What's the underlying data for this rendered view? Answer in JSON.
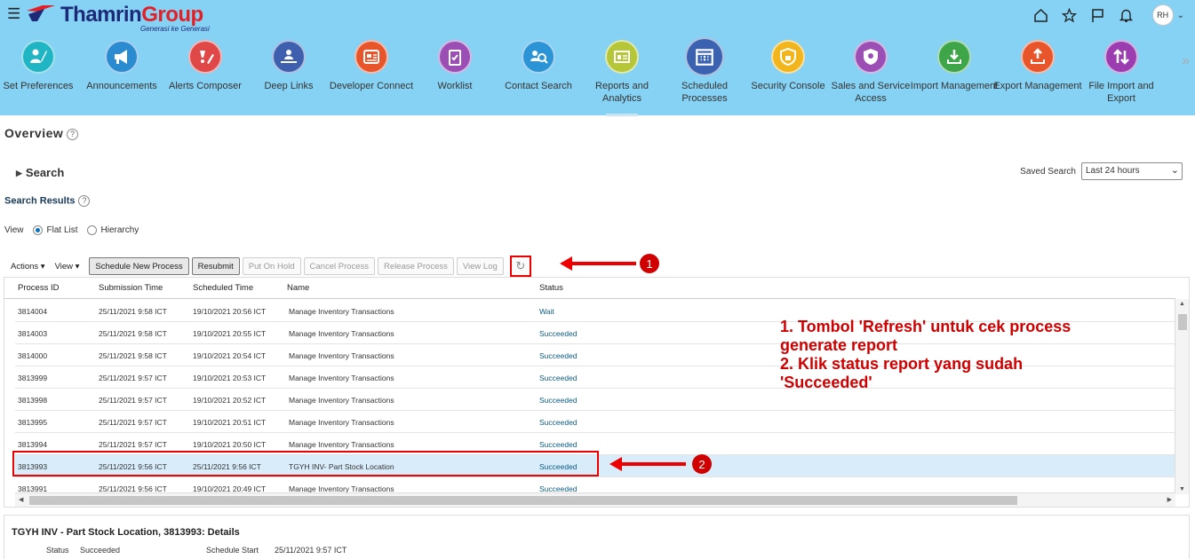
{
  "brand": {
    "name_main": "Thamrin",
    "name_group": "Group",
    "tagline": "Generasi ke Generasi"
  },
  "top_icons": [
    "home-icon",
    "star-icon",
    "flag-icon",
    "bell-icon"
  ],
  "user": {
    "initials": "RH"
  },
  "apps": [
    {
      "label": "Set Preferences",
      "color": "#1fb5c4"
    },
    {
      "label": "Announcements",
      "color": "#2a8bd0"
    },
    {
      "label": "Alerts Composer",
      "color": "#e04848"
    },
    {
      "label": "Deep Links",
      "color": "#3e5fae"
    },
    {
      "label": "Developer Connect",
      "color": "#e8552b"
    },
    {
      "label": "Worklist",
      "color": "#9b4fb5"
    },
    {
      "label": "Contact Search",
      "color": "#2a94d6"
    },
    {
      "label": "Reports and Analytics",
      "color": "#b5c737"
    },
    {
      "label": "Scheduled Processes",
      "color": "#3b62b0"
    },
    {
      "label": "Security Console",
      "color": "#f2b51c"
    },
    {
      "label": "Sales and Service Access",
      "color": "#9b4fb5"
    },
    {
      "label": "Import Management",
      "color": "#3ea548"
    },
    {
      "label": "Export Management",
      "color": "#e8552b"
    },
    {
      "label": "File Import and Export",
      "color": "#9b3db0"
    }
  ],
  "overview": {
    "title": "Overview"
  },
  "search": {
    "label": "Search",
    "saved_label": "Saved Search",
    "saved_value": "Last 24 hours"
  },
  "results": {
    "title": "Search Results"
  },
  "view": {
    "label": "View",
    "flat": "Flat List",
    "hierarchy": "Hierarchy"
  },
  "toolbar": {
    "actions": "Actions",
    "view": "View",
    "schedule": "Schedule New Process",
    "resubmit": "Resubmit",
    "hold": "Put On Hold",
    "cancel": "Cancel Process",
    "release": "Release Process",
    "viewlog": "View Log"
  },
  "columns": [
    "Process ID",
    "Submission Time",
    "Scheduled Time",
    "Name",
    "Status"
  ],
  "rows": [
    [
      "3814004",
      "25/11/2021 9:58 ICT",
      "19/10/2021 20:56 ICT",
      "Manage Inventory Transactions",
      "Wait"
    ],
    [
      "3814003",
      "25/11/2021 9:58 ICT",
      "19/10/2021 20:55 ICT",
      "Manage Inventory Transactions",
      "Succeeded"
    ],
    [
      "3814000",
      "25/11/2021 9:58 ICT",
      "19/10/2021 20:54 ICT",
      "Manage Inventory Transactions",
      "Succeeded"
    ],
    [
      "3813999",
      "25/11/2021 9:57 ICT",
      "19/10/2021 20:53 ICT",
      "Manage Inventory Transactions",
      "Succeeded"
    ],
    [
      "3813998",
      "25/11/2021 9:57 ICT",
      "19/10/2021 20:52 ICT",
      "Manage Inventory Transactions",
      "Succeeded"
    ],
    [
      "3813995",
      "25/11/2021 9:57 ICT",
      "19/10/2021 20:51 ICT",
      "Manage Inventory Transactions",
      "Succeeded"
    ],
    [
      "3813994",
      "25/11/2021 9:57 ICT",
      "19/10/2021 20:50 ICT",
      "Manage Inventory Transactions",
      "Succeeded"
    ],
    [
      "3813993",
      "25/11/2021 9:56 ICT",
      "25/11/2021 9:56 ICT",
      "TGYH INV- Part Stock Location",
      "Succeeded"
    ],
    [
      "3813991",
      "25/11/2021 9:56 ICT",
      "19/10/2021 20:49 ICT",
      "Manage Inventory Transactions",
      "Succeeded"
    ]
  ],
  "callouts": {
    "one": "1",
    "two": "2"
  },
  "note": {
    "line1": "1. Tombol 'Refresh' untuk cek process",
    "line2": "generate report",
    "line3": "2. Klik status report yang sudah",
    "line4": "'Succeeded'"
  },
  "details": {
    "title": "TGYH INV - Part Stock Location, 3813993: Details",
    "status_label": "Status",
    "status_value": "Succeeded",
    "start_label": "Schedule Start",
    "start_value": "25/11/2021 9:57 ICT"
  },
  "colors": {
    "header_bg": "#86d2f4",
    "annotation": "#d10000",
    "selected_row": "#d9ecfa",
    "status_link": "#0b5b82"
  }
}
